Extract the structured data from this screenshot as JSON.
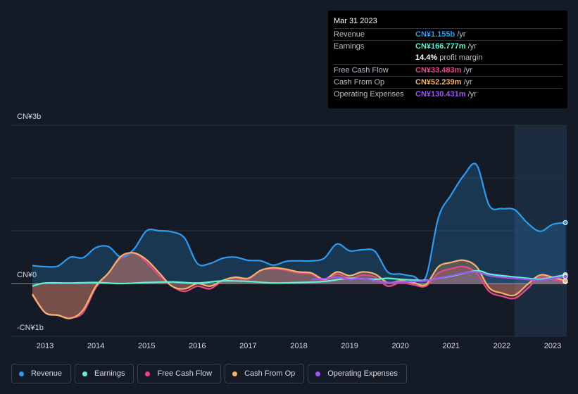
{
  "tooltip": {
    "date": "Mar 31 2023",
    "rows": [
      {
        "label": "Revenue",
        "value": "CN¥1.155b",
        "unit": "/yr",
        "color": "#2d9bf0"
      },
      {
        "label": "Earnings",
        "value": "CN¥166.777m",
        "unit": "/yr",
        "color": "#5ef2d0"
      },
      {
        "label": "",
        "value": "14.4%",
        "unit": "profit margin",
        "color": "#ffffff"
      },
      {
        "label": "Free Cash Flow",
        "value": "CN¥33.483m",
        "unit": "/yr",
        "color": "#e34a86"
      },
      {
        "label": "Cash From Op",
        "value": "CN¥52.239m",
        "unit": "/yr",
        "color": "#f2b26b"
      },
      {
        "label": "Operating Expenses",
        "value": "CN¥130.431m",
        "unit": "/yr",
        "color": "#a154f2"
      }
    ]
  },
  "legend": [
    {
      "label": "Revenue",
      "color": "#2d9bf0"
    },
    {
      "label": "Earnings",
      "color": "#5ef2d0"
    },
    {
      "label": "Free Cash Flow",
      "color": "#e34a86"
    },
    {
      "label": "Cash From Op",
      "color": "#f2b26b"
    },
    {
      "label": "Operating Expenses",
      "color": "#a154f2"
    }
  ],
  "chart_data": {
    "type": "area",
    "y_unit": "CN¥ billions",
    "ylim": [
      -1,
      3
    ],
    "y_tick_labels": [
      {
        "value": 3,
        "label": "CN¥3b"
      },
      {
        "value": 0,
        "label": "CN¥0"
      },
      {
        "value": -1,
        "label": "-CN¥1b"
      }
    ],
    "xlim": [
      2012.75,
      2023.25
    ],
    "x_ticks": [
      2013,
      2014,
      2015,
      2016,
      2017,
      2018,
      2019,
      2020,
      2021,
      2022,
      2023
    ],
    "highlight_from": 2022.25,
    "series": [
      {
        "name": "Revenue",
        "color": "#2d9bf0",
        "points": [
          [
            2012.75,
            0.34
          ],
          [
            2013.0,
            0.32
          ],
          [
            2013.25,
            0.33
          ],
          [
            2013.5,
            0.5
          ],
          [
            2013.75,
            0.49
          ],
          [
            2014.0,
            0.68
          ],
          [
            2014.25,
            0.7
          ],
          [
            2014.5,
            0.5
          ],
          [
            2014.75,
            0.65
          ],
          [
            2015.0,
            1.0
          ],
          [
            2015.25,
            1.0
          ],
          [
            2015.5,
            0.98
          ],
          [
            2015.75,
            0.86
          ],
          [
            2016.0,
            0.38
          ],
          [
            2016.25,
            0.38
          ],
          [
            2016.5,
            0.48
          ],
          [
            2016.75,
            0.5
          ],
          [
            2017.0,
            0.44
          ],
          [
            2017.25,
            0.43
          ],
          [
            2017.5,
            0.35
          ],
          [
            2017.75,
            0.42
          ],
          [
            2018.0,
            0.43
          ],
          [
            2018.25,
            0.43
          ],
          [
            2018.5,
            0.48
          ],
          [
            2018.75,
            0.75
          ],
          [
            2019.0,
            0.62
          ],
          [
            2019.25,
            0.64
          ],
          [
            2019.5,
            0.61
          ],
          [
            2019.75,
            0.22
          ],
          [
            2020.0,
            0.18
          ],
          [
            2020.25,
            0.14
          ],
          [
            2020.5,
            0.12
          ],
          [
            2020.75,
            1.25
          ],
          [
            2021.0,
            1.68
          ],
          [
            2021.25,
            2.05
          ],
          [
            2021.5,
            2.25
          ],
          [
            2021.75,
            1.48
          ],
          [
            2022.0,
            1.42
          ],
          [
            2022.25,
            1.4
          ],
          [
            2022.5,
            1.15
          ],
          [
            2022.75,
            0.99
          ],
          [
            2023.0,
            1.12
          ],
          [
            2023.25,
            1.155
          ]
        ]
      },
      {
        "name": "Earnings",
        "color": "#5ef2d0",
        "points": [
          [
            2012.75,
            -0.05
          ],
          [
            2013.0,
            0.01
          ],
          [
            2013.5,
            0.01
          ],
          [
            2014.0,
            0.02
          ],
          [
            2014.5,
            0.0
          ],
          [
            2015.0,
            0.02
          ],
          [
            2015.5,
            0.03
          ],
          [
            2016.0,
            0.01
          ],
          [
            2016.5,
            0.05
          ],
          [
            2017.0,
            0.04
          ],
          [
            2017.5,
            0.01
          ],
          [
            2018.0,
            0.02
          ],
          [
            2018.5,
            0.04
          ],
          [
            2019.0,
            0.1
          ],
          [
            2019.5,
            0.08
          ],
          [
            2019.75,
            0.1
          ],
          [
            2020.0,
            0.08
          ],
          [
            2020.5,
            0.06
          ],
          [
            2020.75,
            0.1
          ],
          [
            2021.0,
            0.14
          ],
          [
            2021.5,
            0.24
          ],
          [
            2021.75,
            0.18
          ],
          [
            2022.0,
            0.15
          ],
          [
            2022.5,
            0.1
          ],
          [
            2022.75,
            0.08
          ],
          [
            2023.0,
            0.12
          ],
          [
            2023.25,
            0.167
          ]
        ]
      },
      {
        "name": "Free Cash Flow",
        "color": "#e34a86",
        "points": [
          [
            2012.75,
            -0.22
          ],
          [
            2013.0,
            -0.55
          ],
          [
            2013.25,
            -0.6
          ],
          [
            2013.5,
            -0.65
          ],
          [
            2013.75,
            -0.55
          ],
          [
            2014.0,
            -0.08
          ],
          [
            2014.25,
            0.2
          ],
          [
            2014.5,
            0.5
          ],
          [
            2014.75,
            0.58
          ],
          [
            2015.0,
            0.4
          ],
          [
            2015.25,
            0.15
          ],
          [
            2015.5,
            -0.05
          ],
          [
            2015.75,
            -0.15
          ],
          [
            2016.0,
            -0.05
          ],
          [
            2016.25,
            -0.1
          ],
          [
            2016.5,
            0.05
          ],
          [
            2016.75,
            0.1
          ],
          [
            2017.0,
            0.08
          ],
          [
            2017.25,
            0.25
          ],
          [
            2017.5,
            0.28
          ],
          [
            2017.75,
            0.25
          ],
          [
            2018.0,
            0.2
          ],
          [
            2018.25,
            0.18
          ],
          [
            2018.5,
            0.05
          ],
          [
            2018.75,
            0.18
          ],
          [
            2019.0,
            0.1
          ],
          [
            2019.25,
            0.16
          ],
          [
            2019.5,
            0.12
          ],
          [
            2019.75,
            -0.05
          ],
          [
            2020.0,
            0.02
          ],
          [
            2020.25,
            -0.02
          ],
          [
            2020.5,
            -0.05
          ],
          [
            2020.75,
            0.2
          ],
          [
            2021.0,
            0.28
          ],
          [
            2021.25,
            0.32
          ],
          [
            2021.5,
            0.2
          ],
          [
            2021.75,
            -0.15
          ],
          [
            2022.0,
            -0.24
          ],
          [
            2022.25,
            -0.28
          ],
          [
            2022.5,
            -0.1
          ],
          [
            2022.75,
            0.12
          ],
          [
            2023.0,
            0.08
          ],
          [
            2023.25,
            0.033
          ]
        ]
      },
      {
        "name": "Cash From Op",
        "color": "#f2b26b",
        "points": [
          [
            2012.75,
            -0.2
          ],
          [
            2013.0,
            -0.55
          ],
          [
            2013.25,
            -0.6
          ],
          [
            2013.5,
            -0.66
          ],
          [
            2013.75,
            -0.5
          ],
          [
            2014.0,
            -0.05
          ],
          [
            2014.25,
            0.2
          ],
          [
            2014.5,
            0.52
          ],
          [
            2014.75,
            0.58
          ],
          [
            2015.0,
            0.45
          ],
          [
            2015.25,
            0.2
          ],
          [
            2015.5,
            -0.05
          ],
          [
            2015.75,
            -0.1
          ],
          [
            2016.0,
            0.0
          ],
          [
            2016.25,
            -0.05
          ],
          [
            2016.5,
            0.06
          ],
          [
            2016.75,
            0.12
          ],
          [
            2017.0,
            0.1
          ],
          [
            2017.25,
            0.25
          ],
          [
            2017.5,
            0.3
          ],
          [
            2017.75,
            0.27
          ],
          [
            2018.0,
            0.22
          ],
          [
            2018.25,
            0.2
          ],
          [
            2018.5,
            0.08
          ],
          [
            2018.75,
            0.22
          ],
          [
            2019.0,
            0.15
          ],
          [
            2019.25,
            0.22
          ],
          [
            2019.5,
            0.18
          ],
          [
            2019.75,
            0.02
          ],
          [
            2020.0,
            0.05
          ],
          [
            2020.25,
            0.02
          ],
          [
            2020.5,
            -0.02
          ],
          [
            2020.75,
            0.32
          ],
          [
            2021.0,
            0.4
          ],
          [
            2021.25,
            0.44
          ],
          [
            2021.5,
            0.32
          ],
          [
            2021.75,
            -0.08
          ],
          [
            2022.0,
            -0.18
          ],
          [
            2022.25,
            -0.22
          ],
          [
            2022.5,
            -0.02
          ],
          [
            2022.75,
            0.16
          ],
          [
            2023.0,
            0.12
          ],
          [
            2023.25,
            0.052
          ]
        ]
      },
      {
        "name": "Operating Expenses",
        "color": "#a154f2",
        "points": [
          [
            2018.25,
            0.08
          ],
          [
            2018.5,
            0.09
          ],
          [
            2018.75,
            0.12
          ],
          [
            2019.0,
            0.08
          ],
          [
            2019.25,
            0.1
          ],
          [
            2019.5,
            0.05
          ],
          [
            2019.75,
            0.02
          ],
          [
            2020.0,
            0.03
          ],
          [
            2020.25,
            0.04
          ],
          [
            2020.5,
            0.05
          ],
          [
            2020.75,
            0.1
          ],
          [
            2021.0,
            0.15
          ],
          [
            2021.25,
            0.2
          ],
          [
            2021.5,
            0.22
          ],
          [
            2021.75,
            0.15
          ],
          [
            2022.0,
            0.12
          ],
          [
            2022.25,
            0.1
          ],
          [
            2022.5,
            0.08
          ],
          [
            2022.75,
            0.06
          ],
          [
            2023.0,
            0.1
          ],
          [
            2023.25,
            0.13
          ]
        ]
      }
    ]
  }
}
